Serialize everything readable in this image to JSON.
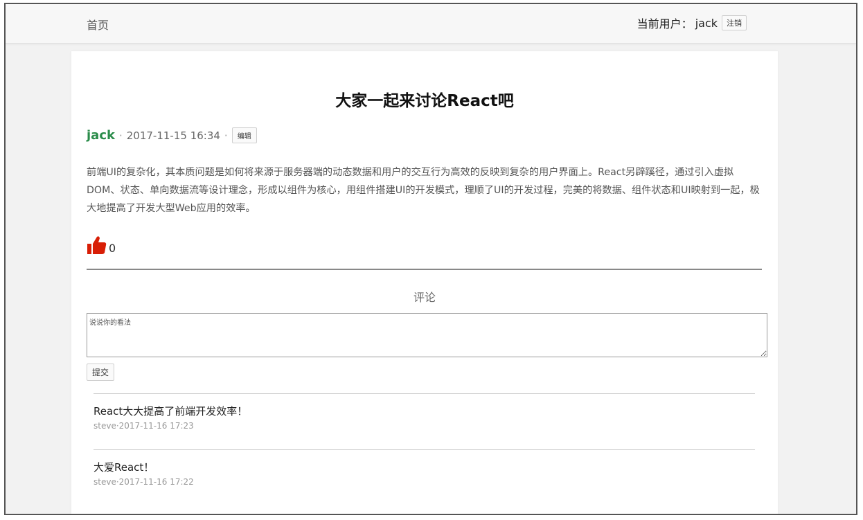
{
  "header": {
    "home_label": "首页",
    "user_prefix": "当前用户：",
    "username": "jack",
    "logout_label": "注销"
  },
  "post": {
    "title": "大家一起来讨论React吧",
    "author": "jack",
    "separator": "·",
    "date": "2017-11-15 16:34",
    "edit_label": "编辑",
    "body": "前端UI的复杂化，其本质问题是如何将来源于服务器端的动态数据和用户的交互行为高效的反映到复杂的用户界面上。React另辟蹊径，通过引入虚拟DOM、状态、单向数据流等设计理念，形成以组件为核心，用组件搭建UI的开发模式，理顺了UI的开发过程，完美的将数据、组件状态和UI映射到一起，极大地提高了开发大型Web应用的效率。",
    "likes": "0",
    "like_icon": "thumbs-up-icon",
    "author_color": "#2a8c4a",
    "like_color": "#d81e06"
  },
  "comments_section": {
    "heading": "评论",
    "input_placeholder": "说说你的看法",
    "submit_label": "提交",
    "items": [
      {
        "text": "React大大提高了前端开发效率！",
        "meta": "steve·2017-11-16 17:23"
      },
      {
        "text": "大爱React！",
        "meta": "steve·2017-11-16 17:22"
      }
    ]
  }
}
